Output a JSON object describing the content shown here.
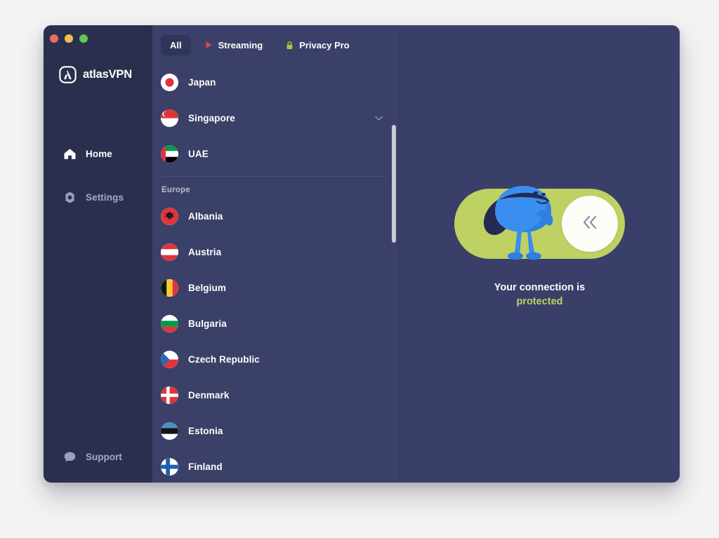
{
  "window": {
    "traffic_lights": [
      {
        "name": "close",
        "color": "#ec6a5e"
      },
      {
        "name": "minimize",
        "color": "#f3bf4f"
      },
      {
        "name": "zoom",
        "color": "#62c554"
      }
    ]
  },
  "sidebar": {
    "brand": "atlasVPN",
    "brand_icon": "atlasvpn-logo-icon",
    "items": [
      {
        "label": "Home",
        "icon": "home-icon",
        "active": true
      },
      {
        "label": "Settings",
        "icon": "gear-icon",
        "active": false
      }
    ],
    "support": {
      "label": "Support",
      "icon": "chat-bubble-icon"
    }
  },
  "tabs": [
    {
      "label": "All",
      "icon": null,
      "selected": true
    },
    {
      "label": "Streaming",
      "icon": "play-triangle-icon",
      "selected": false
    },
    {
      "label": "Privacy Pro",
      "icon": "lock-icon",
      "selected": false
    }
  ],
  "countries": [
    {
      "name": "Japan",
      "flag": "jp",
      "expandable": false
    },
    {
      "name": "Singapore",
      "flag": "sg",
      "expandable": true
    },
    {
      "name": "UAE",
      "flag": "ae",
      "expandable": false
    }
  ],
  "region": {
    "label": "Europe",
    "countries": [
      {
        "name": "Albania",
        "flag": "al"
      },
      {
        "name": "Austria",
        "flag": "at"
      },
      {
        "name": "Belgium",
        "flag": "be"
      },
      {
        "name": "Bulgaria",
        "flag": "bg"
      },
      {
        "name": "Czech Republic",
        "flag": "cz"
      },
      {
        "name": "Denmark",
        "flag": "dk"
      },
      {
        "name": "Estonia",
        "flag": "ee"
      },
      {
        "name": "Finland",
        "flag": "fi"
      }
    ]
  },
  "connection": {
    "state": "on",
    "knob_icon": "double-chevron-left-icon",
    "mascot_icon": "superhero-mascot-icon",
    "status_line1": "Your connection is",
    "status_line2": "protected",
    "track_color": "#bed163",
    "status_color": "#bed163"
  }
}
